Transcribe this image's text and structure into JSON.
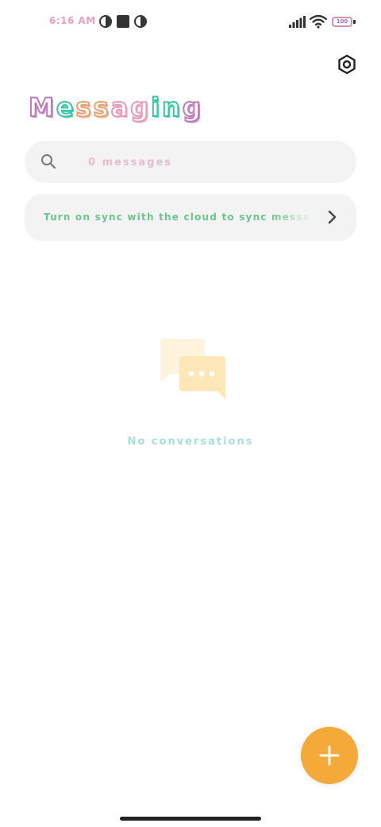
{
  "status_bar": {
    "time": "6:16 AM",
    "battery": "100",
    "icons": [
      "notification-circle-icon",
      "square-icon",
      "notification-circle-icon",
      "signal-icon",
      "wifi-icon",
      "battery-icon"
    ]
  },
  "header": {
    "title": [
      "M",
      "e",
      "s",
      "s",
      "a",
      "g",
      "i",
      "n",
      "g"
    ],
    "settings_icon": "gear-icon"
  },
  "search": {
    "placeholder": "0 messages",
    "value": ""
  },
  "sync_banner": {
    "text": "Turn on sync with the cloud to sync messages",
    "chevron_icon": "chevron-right-icon"
  },
  "empty_state": {
    "icon": "chat-bubbles-icon",
    "text": "No conversations"
  },
  "fab": {
    "icon": "plus-icon"
  },
  "colors": {
    "fab": "#f5a938",
    "surface": "#f3f3f3",
    "illustration": "#fde8b8"
  }
}
